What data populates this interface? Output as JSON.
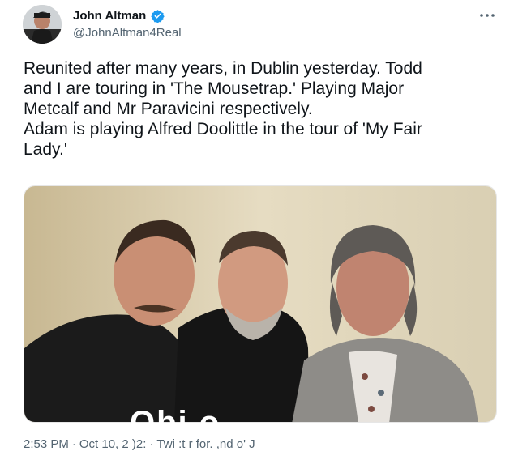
{
  "author": {
    "display_name": "John Altman",
    "handle": "@JohnAltman4Real",
    "verified": true,
    "avatar_icon": "profile-photo"
  },
  "menu": {
    "icon": "more-horizontal-icon"
  },
  "tweet": {
    "text": "Reunited after many years, in Dublin yesterday. Todd\nand I are touring in 'The Mousetrap.' Playing Major\nMetcalf and Mr Paravicini respectively.\nAdam is playing Alfred Doolittle in the tour of 'My Fair\nLady.'"
  },
  "photo": {
    "description_icon": "group-photo-three-men",
    "overlay_text": "Obi   o"
  },
  "meta": {
    "time": "2:53 PM",
    "separator": "·",
    "date": "Oct 10, 2 )2:",
    "source": "Twi :t r for. ,nd o' J"
  },
  "colors": {
    "text_primary": "#0f1419",
    "text_secondary": "#536471",
    "verified_blue": "#1d9bf0",
    "background": "#ffffff"
  }
}
